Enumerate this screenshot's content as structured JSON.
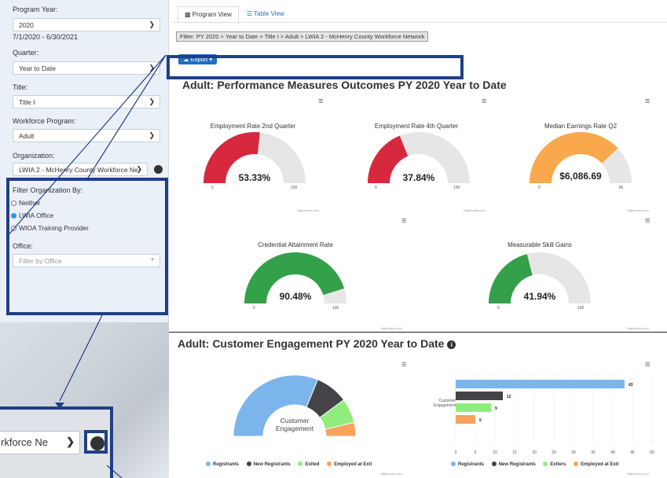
{
  "sidebar": {
    "program_year_label": "Program Year:",
    "program_year_value": "2020",
    "date_range": "7/1/2020 - 6/30/2021",
    "quarter_label": "Quarter:",
    "quarter_value": "Year to Date",
    "title_label": "Title:",
    "title_value": "Title I",
    "workforce_label": "Workforce Program:",
    "workforce_value": "Adult",
    "org_label": "Organization:",
    "org_value": "LWIA 2 - McHenry County Workforce Ne",
    "filter_org_label": "Filter Organization By:",
    "radios": [
      "Neither",
      "LWIA Office",
      "WIOA Training Provider"
    ],
    "office_label": "Office:",
    "office_placeholder": "Filter by Office"
  },
  "zoom": {
    "org_text": "rkforce Ne"
  },
  "tabs": [
    "Program View",
    "Table View"
  ],
  "filter_text": "Filter: PY 2020 > Year to Date > Title I > Adult > LWIA 2 - McHenry County Workforce Network",
  "export_label": "Export",
  "section1_title": "Adult: Performance Measures Outcomes PY 2020 Year to Date",
  "section2_title": "Adult: Customer Engagement PY 2020 Year to Date",
  "credit": "Highcharts.com",
  "chart_data": [
    {
      "type": "gauge",
      "title": "Employment Rate 2nd Quarter",
      "value": 53.33,
      "label": "53.33%",
      "min": "0",
      "max": "100",
      "color": "#d6293e"
    },
    {
      "type": "gauge",
      "title": "Employment Rate 4th Quarter",
      "value": 37.84,
      "label": "37.84%",
      "min": "0",
      "max": "100",
      "color": "#d6293e"
    },
    {
      "type": "gauge",
      "title": "Median Earnings Rate Q2",
      "value": 6086.69,
      "label": "$6,086.69",
      "min": "0",
      "max": "8k",
      "color": "#f9a94b"
    },
    {
      "type": "gauge",
      "title": "Credential Attainment Rate",
      "value": 90.48,
      "label": "90.48%",
      "min": "0",
      "max": "100",
      "color": "#35a04a"
    },
    {
      "type": "gauge",
      "title": "Measurable Skill Gains",
      "value": 41.94,
      "label": "41.94%",
      "min": "0",
      "max": "100",
      "color": "#35a04a"
    },
    {
      "type": "pie",
      "center_label": "Customer Engagement",
      "categories": [
        "Registrants",
        "New Registrants",
        "Exited",
        "Employed at Exit"
      ],
      "values": [
        43,
        12,
        9,
        5
      ],
      "colors": [
        "#7cb5ec",
        "#434348",
        "#90ed7d",
        "#f7a35c"
      ]
    },
    {
      "type": "bar",
      "category": "Customer Engagement",
      "categories": [
        "Registrants",
        "New Registrants",
        "Exiters",
        "Employed at Exit"
      ],
      "values": [
        43,
        12,
        9,
        5
      ],
      "colors": [
        "#7cb5ec",
        "#434348",
        "#90ed7d",
        "#f7a35c"
      ],
      "xlim": [
        0,
        50
      ],
      "ticks": [
        "0",
        "5",
        "10",
        "15",
        "20",
        "25",
        "30",
        "35",
        "40",
        "45",
        "50"
      ]
    }
  ]
}
